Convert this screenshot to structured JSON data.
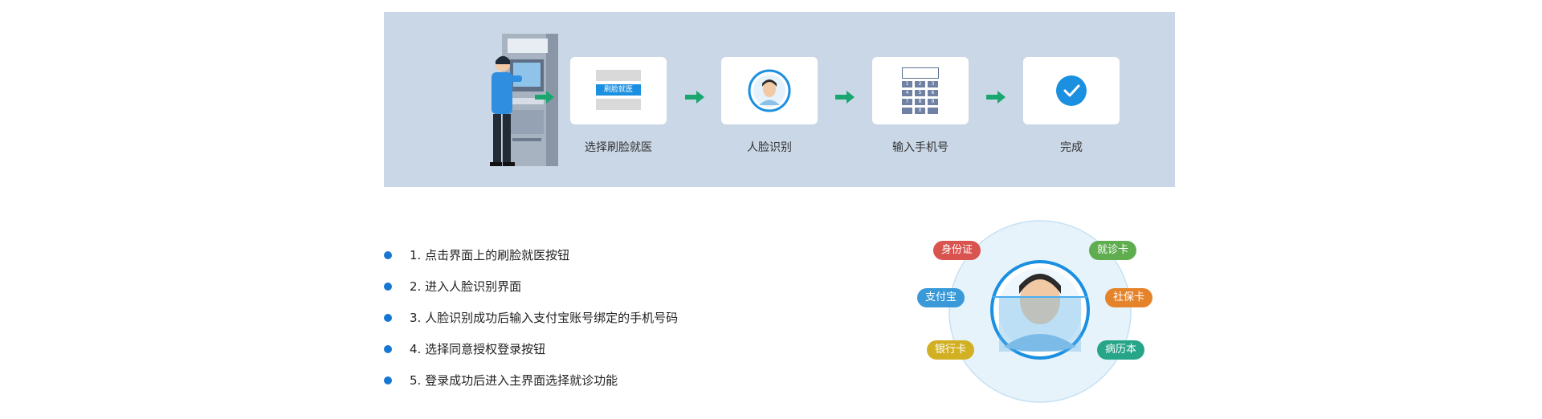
{
  "flow": {
    "steps": [
      {
        "label": "选择刷脸就医",
        "card_text": "刷脸就医"
      },
      {
        "label": "人脸识别"
      },
      {
        "label": "输入手机号",
        "keypad": [
          "1",
          "2",
          "3",
          "4",
          "5",
          "6",
          "7",
          "8",
          "9",
          "",
          "0",
          ""
        ]
      },
      {
        "label": "完成"
      }
    ]
  },
  "instructions": [
    "1. 点击界面上的刷脸就医按钮",
    "2. 进入人脸识别界面",
    "3. 人脸识别成功后输入支付宝账号绑定的手机号码",
    "4. 选择同意授权登录按钮",
    "5. 登录成功后进入主界面选择就诊功能"
  ],
  "tags": {
    "id_card": {
      "label": "身份证",
      "color": "#d9534f"
    },
    "clinic_card": {
      "label": "就诊卡",
      "color": "#5fad4f"
    },
    "alipay": {
      "label": "支付宝",
      "color": "#3a9ad9"
    },
    "social_card": {
      "label": "社保卡",
      "color": "#e5832a"
    },
    "bank_card": {
      "label": "银行卡",
      "color": "#d2b024"
    },
    "medical_record": {
      "label": "病历本",
      "color": "#27a589"
    }
  },
  "colors": {
    "panel": "#c9d7e6",
    "arrow": "#1aa66f",
    "accent": "#1677d2"
  }
}
